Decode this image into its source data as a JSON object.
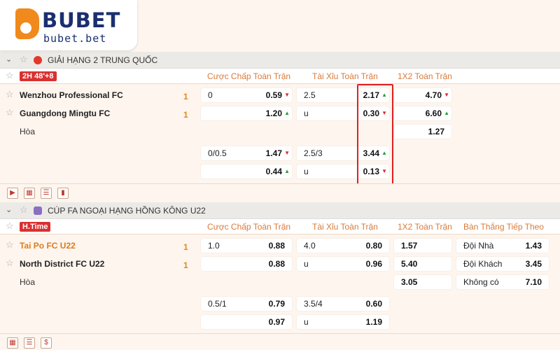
{
  "brand": {
    "name": "BUBET",
    "domain": "bubet.bet"
  },
  "leagues": [
    {
      "name": "GIẢI HẠNG 2 TRUNG QUỐC",
      "status": "2H 48'+8",
      "headers": [
        "Cược Chấp Toàn Trận",
        "Tài Xỉu Toàn Trận",
        "1X2 Toàn Trận"
      ],
      "home": "Wenzhou Professional FC",
      "away": "Guangdong Mingtu FC",
      "home_score": "1",
      "away_score": "1",
      "draw_label": "Hòa",
      "odds": {
        "r1": {
          "hcap_line": "0",
          "hcap_odds": "0.59",
          "ou_line": "2.5",
          "ou_odds": "2.17",
          "x12": "4.70"
        },
        "r2": {
          "hcap_line": "",
          "hcap_odds": "1.20",
          "ou_line": "u",
          "ou_odds": "0.30",
          "x12": "6.60"
        },
        "r3": {
          "x12": "1.27"
        },
        "r4": {
          "hcap_line": "0/0.5",
          "hcap_odds": "1.47",
          "ou_line": "2.5/3",
          "ou_odds": "3.44"
        },
        "r5": {
          "hcap_line": "",
          "hcap_odds": "0.44",
          "ou_line": "u",
          "ou_odds": "0.13"
        }
      }
    },
    {
      "name": "CÚP FA NGOẠI HẠNG HỒNG KÔNG U22",
      "status": "H.Time",
      "headers": [
        "Cược Chấp Toàn Trận",
        "Tài Xỉu Toàn Trận",
        "1X2 Toàn Trận",
        "Bàn Thắng Tiếp Theo"
      ],
      "home": "Tai Po FC U22",
      "away": "North District FC U22",
      "home_score": "1",
      "away_score": "1",
      "draw_label": "Hòa",
      "odds": {
        "r1": {
          "hcap_line": "1.0",
          "hcap_odds": "0.88",
          "ou_line": "4.0",
          "ou_odds": "0.80",
          "x12": "1.57",
          "next_label": "Đội Nhà",
          "next_odds": "1.43"
        },
        "r2": {
          "hcap_line": "",
          "hcap_odds": "0.88",
          "ou_line": "u",
          "ou_odds": "0.96",
          "x12": "5.40",
          "next_label": "Đội Khách",
          "next_odds": "3.45"
        },
        "r3": {
          "x12": "3.05",
          "next_label": "Không có",
          "next_odds": "7.10"
        },
        "r4": {
          "hcap_line": "0.5/1",
          "hcap_odds": "0.79",
          "ou_line": "3.5/4",
          "ou_odds": "0.60"
        },
        "r5": {
          "hcap_line": "",
          "hcap_odds": "0.97",
          "ou_line": "u",
          "ou_odds": "1.19"
        }
      }
    }
  ],
  "colors": {
    "accent": "#d97a3a",
    "live_badge": "#d93030",
    "up": "#2a9a3a",
    "down": "#d92a2a",
    "highlight": "#e02020"
  }
}
